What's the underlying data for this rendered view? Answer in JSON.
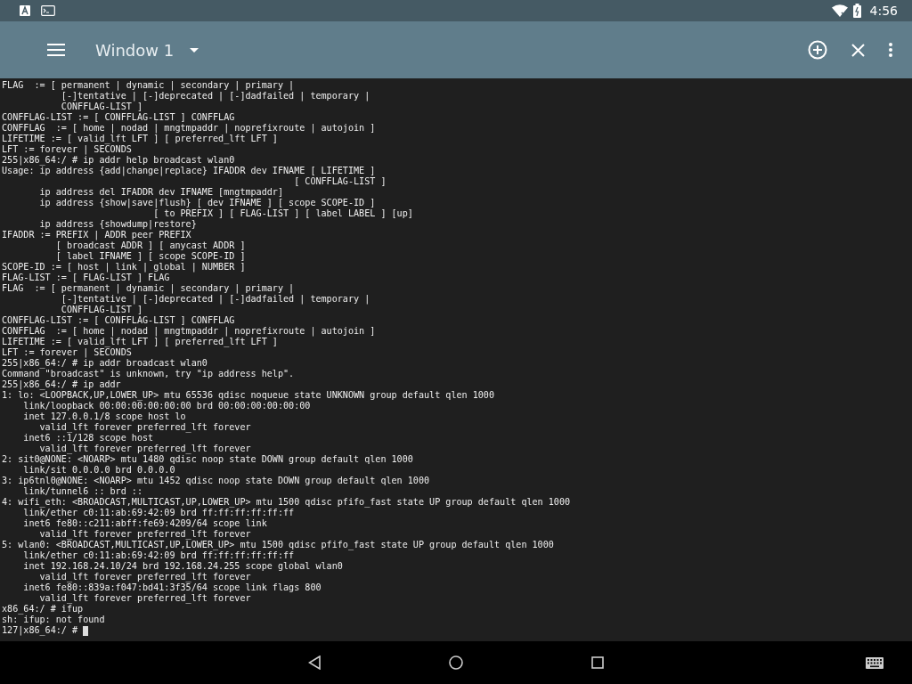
{
  "status_bar": {
    "time": "4:56"
  },
  "toolbar": {
    "window_title": "Window 1"
  },
  "terminal": {
    "lines": [
      "FLAG  := [ permanent | dynamic | secondary | primary |",
      "           [-]tentative | [-]deprecated | [-]dadfailed | temporary |",
      "           CONFFLAG-LIST ]",
      "CONFFLAG-LIST := [ CONFFLAG-LIST ] CONFFLAG",
      "CONFFLAG  := [ home | nodad | mngtmpaddr | noprefixroute | autojoin ]",
      "LIFETIME := [ valid_lft LFT ] [ preferred_lft LFT ]",
      "LFT := forever | SECONDS",
      "255|x86_64:/ # ip addr help broadcast wlan0",
      "Usage: ip address {add|change|replace} IFADDR dev IFNAME [ LIFETIME ]",
      "                                                      [ CONFFLAG-LIST ]",
      "       ip address del IFADDR dev IFNAME [mngtmpaddr]",
      "       ip address {show|save|flush} [ dev IFNAME ] [ scope SCOPE-ID ]",
      "                            [ to PREFIX ] [ FLAG-LIST ] [ label LABEL ] [up]",
      "       ip address {showdump|restore}",
      "IFADDR := PREFIX | ADDR peer PREFIX",
      "          [ broadcast ADDR ] [ anycast ADDR ]",
      "          [ label IFNAME ] [ scope SCOPE-ID ]",
      "SCOPE-ID := [ host | link | global | NUMBER ]",
      "FLAG-LIST := [ FLAG-LIST ] FLAG",
      "FLAG  := [ permanent | dynamic | secondary | primary |",
      "           [-]tentative | [-]deprecated | [-]dadfailed | temporary |",
      "           CONFFLAG-LIST ]",
      "CONFFLAG-LIST := [ CONFFLAG-LIST ] CONFFLAG",
      "CONFFLAG  := [ home | nodad | mngtmpaddr | noprefixroute | autojoin ]",
      "LIFETIME := [ valid_lft LFT ] [ preferred_lft LFT ]",
      "LFT := forever | SECONDS",
      "255|x86_64:/ # ip addr broadcast wlan0",
      "Command \"broadcast\" is unknown, try \"ip address help\".",
      "255|x86_64:/ # ip addr",
      "1: lo: <LOOPBACK,UP,LOWER_UP> mtu 65536 qdisc noqueue state UNKNOWN group default qlen 1000",
      "    link/loopback 00:00:00:00:00:00 brd 00:00:00:00:00:00",
      "    inet 127.0.0.1/8 scope host lo",
      "       valid_lft forever preferred_lft forever",
      "    inet6 ::1/128 scope host",
      "       valid_lft forever preferred_lft forever",
      "2: sit0@NONE: <NOARP> mtu 1480 qdisc noop state DOWN group default qlen 1000",
      "    link/sit 0.0.0.0 brd 0.0.0.0",
      "3: ip6tnl0@NONE: <NOARP> mtu 1452 qdisc noop state DOWN group default qlen 1000",
      "    link/tunnel6 :: brd ::",
      "4: wifi_eth: <BROADCAST,MULTICAST,UP,LOWER_UP> mtu 1500 qdisc pfifo_fast state UP group default qlen 1000",
      "    link/ether c0:11:ab:69:42:09 brd ff:ff:ff:ff:ff:ff",
      "    inet6 fe80::c211:abff:fe69:4209/64 scope link",
      "       valid_lft forever preferred_lft forever",
      "5: wlan0: <BROADCAST,MULTICAST,UP,LOWER_UP> mtu 1500 qdisc pfifo_fast state UP group default qlen 1000",
      "    link/ether c0:11:ab:69:42:09 brd ff:ff:ff:ff:ff:ff",
      "    inet 192.168.24.10/24 brd 192.168.24.255 scope global wlan0",
      "       valid_lft forever preferred_lft forever",
      "    inet6 fe80::839a:f047:bd41:3f35/64 scope link flags 800",
      "       valid_lft forever preferred_lft forever",
      "x86_64:/ # ifup",
      "sh: ifup: not found"
    ],
    "prompt": "127|x86_64:/ #"
  }
}
